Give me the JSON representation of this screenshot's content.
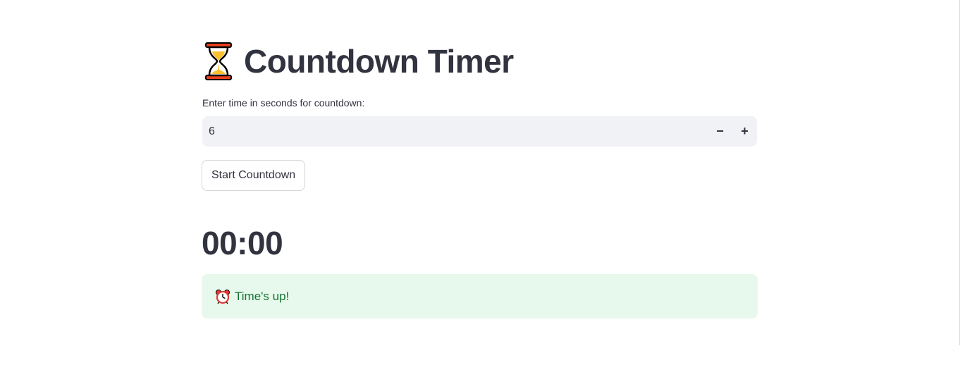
{
  "header": {
    "title": "Countdown Timer",
    "icon": "hourglass-icon"
  },
  "input": {
    "label": "Enter time in seconds for countdown:",
    "value": "6",
    "decrement_symbol": "−",
    "increment_symbol": "+"
  },
  "actions": {
    "start_label": "Start Countdown"
  },
  "timer": {
    "display": "00:00"
  },
  "alert": {
    "icon": "alarm-clock-icon",
    "message": "Time's up!",
    "colors": {
      "background": "#e6f9ec",
      "text": "#177233"
    }
  }
}
